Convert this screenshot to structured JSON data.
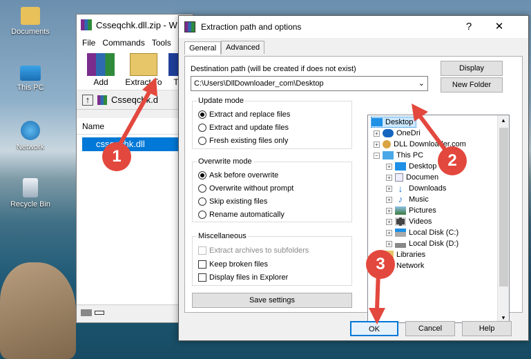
{
  "desktop": {
    "icons": [
      {
        "label": "Documents"
      },
      {
        "label": "This PC"
      },
      {
        "label": "Network"
      },
      {
        "label": "Recycle Bin"
      }
    ]
  },
  "winrar": {
    "title": "Csseqchk.dll.zip - W",
    "menu": [
      "File",
      "Commands",
      "Tools"
    ],
    "toolbar": {
      "add": "Add",
      "extract_to": "Extract To",
      "extra": "T"
    },
    "path": "Csseqchk.d",
    "column_name": "Name",
    "file": "csseqchk.dll"
  },
  "dialog": {
    "title": "Extraction path and options",
    "help_glyph": "?",
    "close_glyph": "✕",
    "tabs": [
      "General",
      "Advanced"
    ],
    "dest_label": "Destination path (will be created if does not exist)",
    "dest_value": "C:\\Users\\DllDownloader_com\\Desktop",
    "display_btn": "Display",
    "new_folder_btn": "New Folder",
    "update_mode": {
      "title": "Update mode",
      "options": [
        "Extract and replace files",
        "Extract and update files",
        "Fresh existing files only"
      ],
      "selected": 0
    },
    "overwrite_mode": {
      "title": "Overwrite mode",
      "options": [
        "Ask before overwrite",
        "Overwrite without prompt",
        "Skip existing files",
        "Rename automatically"
      ],
      "selected": 0
    },
    "misc": {
      "title": "Miscellaneous",
      "options": [
        "Extract archives to subfolders",
        "Keep broken files",
        "Display files in Explorer"
      ]
    },
    "save_settings": "Save settings",
    "tree": {
      "desktop": "Desktop",
      "onedrive": "OneDri",
      "dll": "DLL Downloader.com",
      "thispc": "This PC",
      "children": [
        "Desktop",
        "Documen",
        "Downloads",
        "Music",
        "Pictures",
        "Videos",
        "Local Disk (C:)",
        "Local Disk (D:)"
      ],
      "libraries": "Libraries",
      "network": "Network"
    },
    "ok": "OK",
    "cancel": "Cancel",
    "help": "Help"
  },
  "annotations": {
    "step1": "1",
    "step2": "2",
    "step3": "3"
  },
  "colors": {
    "arrow": "#e3483e",
    "selection": "#0078d7",
    "tree_selection": "#cce8ff"
  }
}
